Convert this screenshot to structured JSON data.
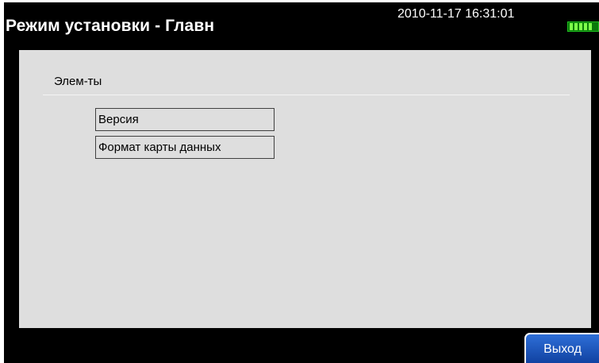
{
  "header": {
    "title": "Режим установки - Главн",
    "datetime": "2010-11-17 16:31:01",
    "battery_icon": "battery-full-icon",
    "battery_color": "#0a7a0a"
  },
  "panel": {
    "section_label": "Элем-ты",
    "items": [
      {
        "label": "Версия"
      },
      {
        "label": "Формат карты данных"
      }
    ]
  },
  "footer": {
    "exit_label": "Выход",
    "exit_color": "#1f56c0"
  },
  "colors": {
    "background": "#000000",
    "panel": "#dedede"
  }
}
